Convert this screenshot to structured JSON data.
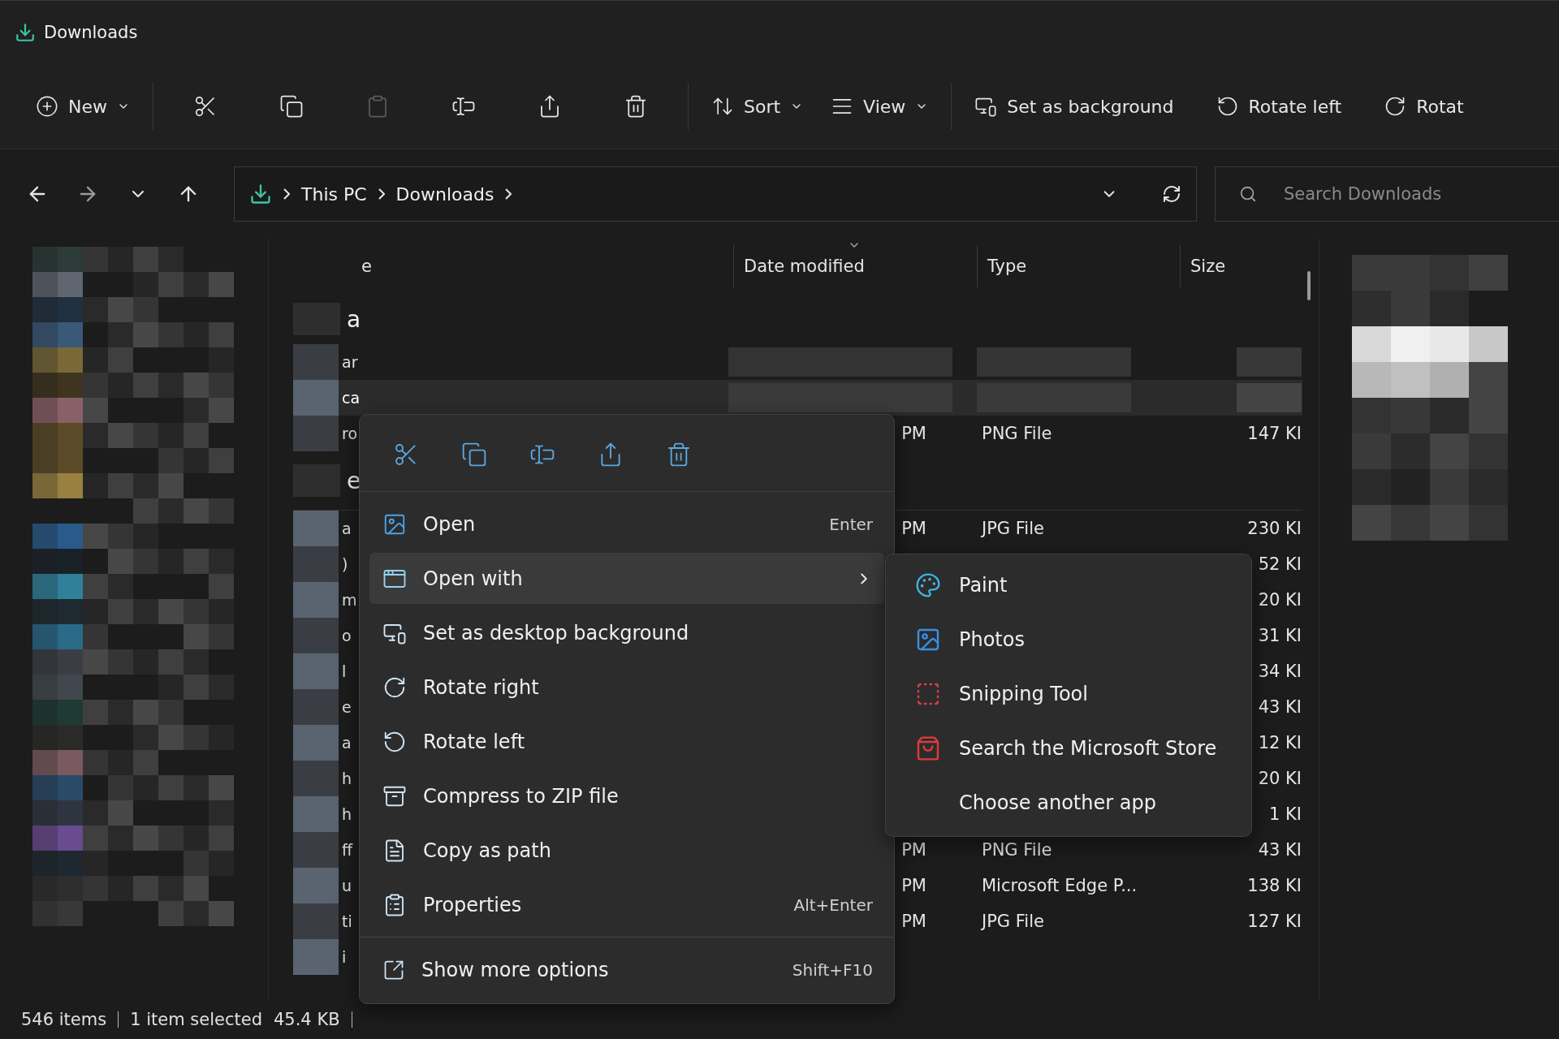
{
  "window": {
    "title": "Downloads"
  },
  "toolbar": [
    {
      "kind": "menu",
      "label": "New",
      "disabled": false
    },
    {
      "kind": "separator"
    },
    {
      "kind": "icon",
      "disabled": false
    },
    {
      "kind": "icon",
      "disabled": false
    },
    {
      "kind": "icon",
      "disabled": true
    },
    {
      "kind": "icon",
      "disabled": false
    },
    {
      "kind": "icon",
      "disabled": false
    },
    {
      "kind": "icon",
      "disabled": false
    },
    {
      "kind": "separator"
    },
    {
      "kind": "menu",
      "label": "Sort",
      "disabled": false
    },
    {
      "kind": "menu",
      "label": "View",
      "disabled": false
    },
    {
      "kind": "separator"
    },
    {
      "kind": "button",
      "label": "Set as background",
      "disabled": false
    },
    {
      "kind": "button",
      "label": "Rotate left",
      "disabled": false
    },
    {
      "kind": "button",
      "label": "Rotat",
      "disabled": false
    }
  ],
  "address": {
    "breadcrumb": [
      "This PC",
      "Downloads"
    ],
    "search_placeholder": "Search Downloads"
  },
  "columns": [
    {
      "label": "e",
      "sorted": false
    },
    {
      "label": "Date modified",
      "sorted": true
    },
    {
      "label": "Type",
      "sorted": false
    },
    {
      "label": "Size",
      "sorted": false
    }
  ],
  "groups": [
    {
      "name": "a",
      "rows": [
        {
          "name": "ar",
          "pixelated": true,
          "selected": false
        },
        {
          "name": "ca",
          "pixelated": true,
          "selected": true
        },
        {
          "name": "ro",
          "date": "PM",
          "type": "PNG File",
          "size": "147 KI",
          "selected": false
        }
      ]
    },
    {
      "name": "e",
      "rows": [
        {
          "name": "a",
          "date": "PM",
          "type": "JPG File",
          "size": "230 KI",
          "selected": false
        },
        {
          "name": ")",
          "size": "52 KI",
          "selected": false
        },
        {
          "name": "m",
          "size": "20 KI",
          "selected": false
        },
        {
          "name": "o",
          "size": "31 KI",
          "selected": false
        },
        {
          "name": "l",
          "size": "34 KI",
          "selected": false
        },
        {
          "name": "e",
          "size": "43 KI",
          "selected": false
        },
        {
          "name": "a",
          "size": "12 KI",
          "selected": false
        },
        {
          "name": "h",
          "size": "20 KI",
          "selected": false
        },
        {
          "name": "h",
          "size": "1 KI",
          "selected": false
        },
        {
          "name": "ff",
          "date": "PM",
          "type": "PNG File",
          "size": "43 KI",
          "selected": false
        },
        {
          "name": "u",
          "date": "PM",
          "type": "Microsoft Edge P...",
          "size": "138 KI",
          "selected": false
        },
        {
          "name": "ti",
          "date": "PM",
          "type": "JPG File",
          "size": "127 KI",
          "selected": false
        },
        {
          "name": "i",
          "selected": false
        }
      ]
    }
  ],
  "context_menu": {
    "items": [
      {
        "label": "Open",
        "shortcut": "Enter",
        "submenu": false,
        "selected": false
      },
      {
        "label": "Open with",
        "submenu": true,
        "selected": true
      },
      {
        "label": "Set as desktop background",
        "submenu": false,
        "selected": false
      },
      {
        "label": "Rotate right",
        "submenu": false,
        "selected": false
      },
      {
        "label": "Rotate left",
        "submenu": false,
        "selected": false
      },
      {
        "label": "Compress to ZIP file",
        "submenu": false,
        "selected": false
      },
      {
        "label": "Copy as path",
        "submenu": false,
        "selected": false
      },
      {
        "label": "Properties",
        "shortcut": "Alt+Enter",
        "submenu": false,
        "selected": false
      }
    ],
    "footer_item": {
      "label": "Show more options",
      "shortcut": "Shift+F10"
    }
  },
  "submenu": [
    {
      "label": "Paint"
    },
    {
      "label": "Photos"
    },
    {
      "label": "Snipping Tool"
    },
    {
      "label": "Search the Microsoft Store"
    },
    {
      "label": "Choose another app"
    }
  ],
  "status_bar": {
    "count": "546 items",
    "selection": "1 item selected",
    "size": "45.4 KB"
  }
}
